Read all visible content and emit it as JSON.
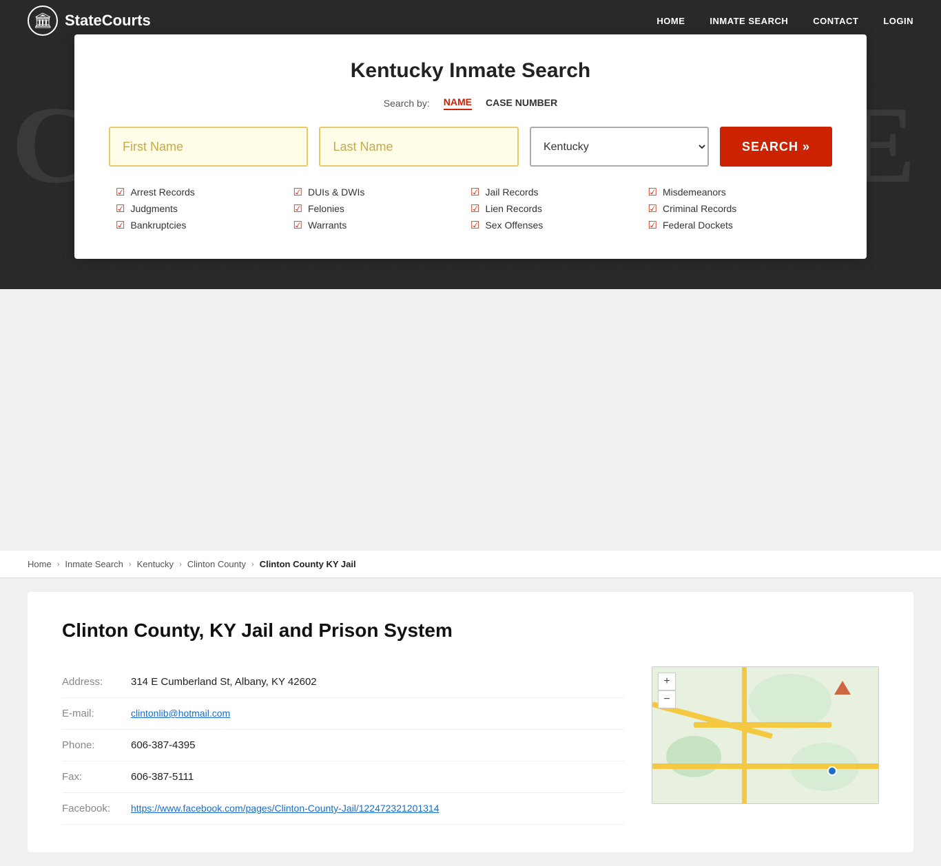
{
  "site": {
    "logo_text": "StateCourts",
    "logo_icon": "🏛"
  },
  "nav": {
    "links": [
      "HOME",
      "INMATE SEARCH",
      "CONTACT",
      "LOGIN"
    ]
  },
  "hero": {
    "bg_text": "COURTHOUSE"
  },
  "search_card": {
    "title": "Kentucky Inmate Search",
    "search_by_label": "Search by:",
    "tabs": [
      {
        "label": "NAME",
        "active": true
      },
      {
        "label": "CASE NUMBER",
        "active": false
      }
    ],
    "first_name_placeholder": "First Name",
    "last_name_placeholder": "Last Name",
    "state_default": "Kentucky",
    "search_button": "SEARCH »",
    "checks": [
      "Arrest Records",
      "DUIs & DWIs",
      "Jail Records",
      "Misdemeanors",
      "Judgments",
      "Felonies",
      "Lien Records",
      "Criminal Records",
      "Bankruptcies",
      "Warrants",
      "Sex Offenses",
      "Federal Dockets"
    ]
  },
  "breadcrumb": {
    "items": [
      "Home",
      "Inmate Search",
      "Kentucky",
      "Clinton County",
      "Clinton County KY Jail"
    ]
  },
  "content": {
    "title": "Clinton County, KY Jail and Prison System",
    "fields": [
      {
        "label": "Address:",
        "value": "314 E Cumberland St, Albany, KY 42602",
        "is_link": false
      },
      {
        "label": "E-mail:",
        "value": "clintonlib@hotmail.com",
        "is_link": true
      },
      {
        "label": "Phone:",
        "value": "606-387-4395",
        "is_link": false
      },
      {
        "label": "Fax:",
        "value": "606-387-5111",
        "is_link": false
      },
      {
        "label": "Facebook:",
        "value": "https://www.facebook.com/pages/Clinton-County-Jail/122472321201314",
        "is_link": true
      }
    ]
  },
  "map": {
    "zoom_in": "+",
    "zoom_out": "−"
  }
}
